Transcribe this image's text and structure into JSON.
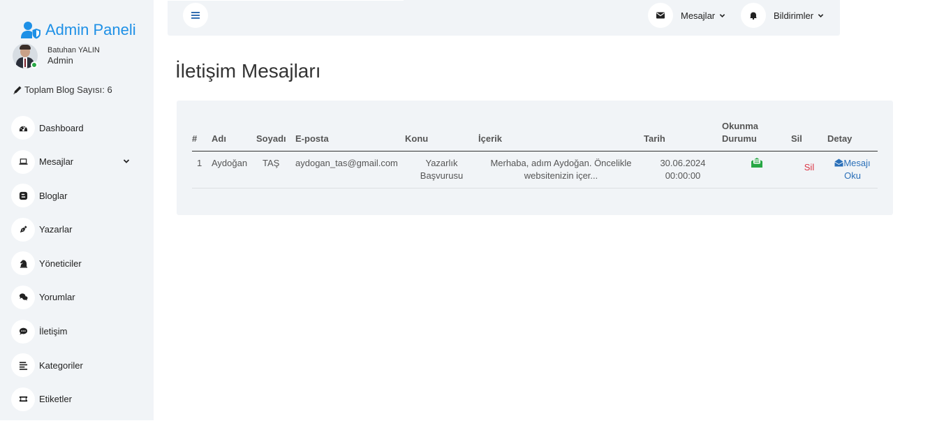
{
  "sidebar": {
    "brand": "Admin Paneli",
    "user_name": "Batuhan YALIN",
    "user_role": "Admin",
    "blog_count": "Toplam Blog Sayısı: 6",
    "items": [
      {
        "label": "Dashboard",
        "icon": "dashboard-icon"
      },
      {
        "label": "Mesajlar",
        "icon": "laptop-icon"
      },
      {
        "label": "Bloglar",
        "icon": "blogger-icon"
      },
      {
        "label": "Yazarlar",
        "icon": "pen-nib-icon"
      },
      {
        "label": "Yöneticiler",
        "icon": "chess-knight-icon"
      },
      {
        "label": "Yorumlar",
        "icon": "comments-icon"
      },
      {
        "label": "İletişim",
        "icon": "comment-dots-icon"
      },
      {
        "label": "Kategoriler",
        "icon": "align-left-icon"
      },
      {
        "label": "Etiketler",
        "icon": "ticket-icon"
      }
    ]
  },
  "topbar": {
    "messages_label": "Mesajlar",
    "notifications_label": "Bildirimler"
  },
  "page": {
    "title": "İletişim Mesajları"
  },
  "table": {
    "headers": {
      "num": "#",
      "name": "Adı",
      "surname": "Soyadı",
      "email": "E-posta",
      "subject": "Konu",
      "content": "İçerik",
      "date": "Tarih",
      "read_status_1": "Okunma",
      "read_status_2": "Durumu",
      "delete": "Sil",
      "detail": "Detay"
    },
    "rows": [
      {
        "num": "1",
        "name": "Aydoğan",
        "surname": "TAŞ",
        "email": "aydogan_tas@gmail.com",
        "subject_1": "Yazarlık",
        "subject_2": "Başvurusu",
        "content_1": "Merhaba, adım Aydoğan. Öncelikle",
        "content_2": "websitenizin içer...",
        "date_1": "30.06.2024",
        "date_2": "00:00:00",
        "delete_label": "Sil",
        "read_label_1": "Mesajı",
        "read_label_2": "Oku"
      }
    ]
  },
  "colors": {
    "accent": "#1e90e6",
    "delete": "#dc3545",
    "read_status": "#28a745",
    "link": "#2a6fb8"
  }
}
